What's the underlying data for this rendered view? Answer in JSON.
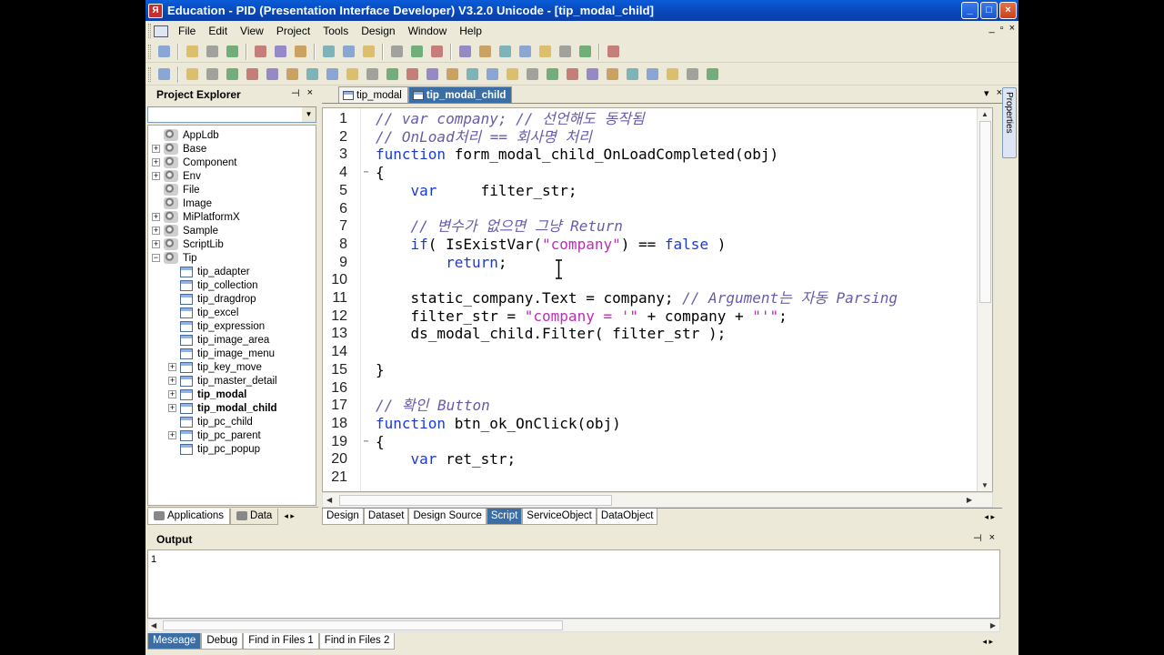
{
  "window": {
    "title": "Education - PID (Presentation Interface Developer) V3.2.0 Unicode - [tip_modal_child]",
    "app_icon": "Я",
    "min": "_",
    "max": "□",
    "close": "×"
  },
  "menu": [
    "File",
    "Edit",
    "View",
    "Project",
    "Tools",
    "Design",
    "Window",
    "Help"
  ],
  "mdi_controls": {
    "min": "_",
    "restore": "▫",
    "close": "×"
  },
  "toolbar1": [
    "open-project-icon",
    "new-file-icon",
    "open-file-icon",
    "save-icon",
    "cut-icon",
    "copy-icon",
    "paste-icon",
    "print-icon",
    "find-icon",
    "replace-icon",
    "build-icon",
    "debug-icon",
    "help-icon",
    "align-left-icon",
    "align-center-icon",
    "align-right-icon",
    "align-top-icon",
    "align-middle-icon",
    "align-bottom-icon",
    "same-width-icon",
    "pin-icon"
  ],
  "toolbar2": [
    "pointer-icon",
    "static-icon",
    "edit-icon",
    "button-icon",
    "combo-icon",
    "checkbox-icon",
    "radio-icon",
    "image-icon",
    "shape-icon",
    "list-icon",
    "grid-icon",
    "tab-icon",
    "calendar-icon",
    "spin-icon",
    "treeview-icon",
    "menu-icon",
    "div-icon",
    "progress-icon",
    "chart-icon",
    "media-icon",
    "web-icon",
    "graphic-icon",
    "table-icon",
    "scroll-icon",
    "group-icon",
    "rich-icon",
    "ocx-icon",
    "plugin-icon"
  ],
  "project_explorer": {
    "title": "Project Explorer",
    "pin": "⊣",
    "close": "×",
    "combo_value": "",
    "tree": [
      {
        "label": "AppLdb",
        "expander": "",
        "icon": "gears-icon",
        "level": 0
      },
      {
        "label": "Base",
        "expander": "+",
        "icon": "gears-icon",
        "level": 0
      },
      {
        "label": "Component",
        "expander": "+",
        "icon": "gears-icon",
        "level": 0
      },
      {
        "label": "Env",
        "expander": "+",
        "icon": "gears-icon",
        "level": 0
      },
      {
        "label": "File",
        "expander": "",
        "icon": "gears-icon",
        "level": 0
      },
      {
        "label": "Image",
        "expander": "",
        "icon": "gears-icon",
        "level": 0
      },
      {
        "label": "MiPlatformX",
        "expander": "+",
        "icon": "gears-icon",
        "level": 0
      },
      {
        "label": "Sample",
        "expander": "+",
        "icon": "gears-icon",
        "level": 0
      },
      {
        "label": "ScriptLib",
        "expander": "+",
        "icon": "gears-icon",
        "level": 0
      },
      {
        "label": "Tip",
        "expander": "−",
        "icon": "gears-icon",
        "level": 0
      },
      {
        "label": "tip_adapter",
        "expander": "",
        "icon": "form-icon",
        "level": 1
      },
      {
        "label": "tip_collection",
        "expander": "",
        "icon": "form-icon",
        "level": 1
      },
      {
        "label": "tip_dragdrop",
        "expander": "",
        "icon": "form-icon",
        "level": 1
      },
      {
        "label": "tip_excel",
        "expander": "",
        "icon": "form-icon",
        "level": 1
      },
      {
        "label": "tip_expression",
        "expander": "",
        "icon": "form-icon",
        "level": 1
      },
      {
        "label": "tip_image_area",
        "expander": "",
        "icon": "form-icon",
        "level": 1
      },
      {
        "label": "tip_image_menu",
        "expander": "",
        "icon": "form-icon",
        "level": 1
      },
      {
        "label": "tip_key_move",
        "expander": "+",
        "icon": "form-icon",
        "level": 1
      },
      {
        "label": "tip_master_detail",
        "expander": "+",
        "icon": "form-icon",
        "level": 1
      },
      {
        "label": "tip_modal",
        "expander": "+",
        "icon": "form-icon",
        "level": 1,
        "bold": true
      },
      {
        "label": "tip_modal_child",
        "expander": "+",
        "icon": "form-icon",
        "level": 1,
        "bold": true,
        "selected": true
      },
      {
        "label": "tip_pc_child",
        "expander": "",
        "icon": "form-icon",
        "level": 1
      },
      {
        "label": "tip_pc_parent",
        "expander": "+",
        "icon": "form-icon",
        "level": 1
      },
      {
        "label": "tip_pc_popup",
        "expander": "",
        "icon": "form-icon",
        "level": 1
      }
    ],
    "tabs": [
      "Applications",
      "Data"
    ],
    "tab_arrows": "◂ ▸"
  },
  "doc_tabs": [
    "tip_modal",
    "tip_modal_child"
  ],
  "doc_tab_controls": {
    "dropdown": "▾",
    "close": "×"
  },
  "editor": {
    "lines": [
      {
        "n": "1",
        "fold": "",
        "html": "<span class=\"cm\">// var company; // 선언해도 동작됨</span>"
      },
      {
        "n": "2",
        "fold": "",
        "html": "<span class=\"cm\">// OnLoad처리 == 회사명 처리</span>"
      },
      {
        "n": "3",
        "fold": "",
        "html": "<span class=\"kw\">function</span> form_modal_child_OnLoadCompleted(obj)"
      },
      {
        "n": "4",
        "fold": "−",
        "html": "{"
      },
      {
        "n": "5",
        "fold": "",
        "html": "    <span class=\"kw\">var</span>     filter_str;"
      },
      {
        "n": "6",
        "fold": "",
        "html": ""
      },
      {
        "n": "7",
        "fold": "",
        "html": "    <span class=\"cm\">// 변수가 없으면 그냥 Return</span>"
      },
      {
        "n": "8",
        "fold": "",
        "html": "    <span class=\"kw\">if</span>( IsExistVar(<span class=\"st\">\"company\"</span>) == <span class=\"kw\">false</span> )"
      },
      {
        "n": "9",
        "fold": "",
        "html": "        <span class=\"kw\">return</span>;"
      },
      {
        "n": "10",
        "fold": "",
        "html": ""
      },
      {
        "n": "11",
        "fold": "",
        "html": "    static_company.Text = company; <span class=\"cm\">// Argument는 자동 Parsing</span>"
      },
      {
        "n": "12",
        "fold": "",
        "html": "    filter_str = <span class=\"st\">\"company = '\"</span> + company + <span class=\"st\">\"'\"</span>;"
      },
      {
        "n": "13",
        "fold": "",
        "html": "    ds_modal_child.Filter( filter_str );"
      },
      {
        "n": "14",
        "fold": "",
        "html": ""
      },
      {
        "n": "15",
        "fold": "",
        "html": "}"
      },
      {
        "n": "16",
        "fold": "",
        "html": ""
      },
      {
        "n": "17",
        "fold": "",
        "html": "<span class=\"cm\">// 확인 Button</span>"
      },
      {
        "n": "18",
        "fold": "",
        "html": "<span class=\"kw\">function</span> btn_ok_OnClick(obj)"
      },
      {
        "n": "19",
        "fold": "−",
        "html": "{"
      },
      {
        "n": "20",
        "fold": "",
        "html": "    <span class=\"kw\">var</span> ret_str;"
      },
      {
        "n": "21",
        "fold": "",
        "html": ""
      }
    ]
  },
  "editor_tabs": [
    "Design",
    "Dataset",
    "Design Source",
    "Script",
    "ServiceObject",
    "DataObject"
  ],
  "editor_tabs_active": "Script",
  "editor_tab_arrows": "◂ ▸",
  "properties_label": "Properties",
  "output": {
    "title": "Output",
    "pin": "⊣",
    "close": "×",
    "first_line": "1",
    "tabs": [
      "Meseage",
      "Debug",
      "Find in Files 1",
      "Find in Files 2"
    ],
    "tab_arrows": "◂ ▸"
  },
  "colors": {
    "titlebar": "#0a50c8",
    "active_tab": "#3a6ea5",
    "keyword": "#1a3ad8",
    "comment": "#6a5aaa",
    "string": "#c02cb8"
  }
}
